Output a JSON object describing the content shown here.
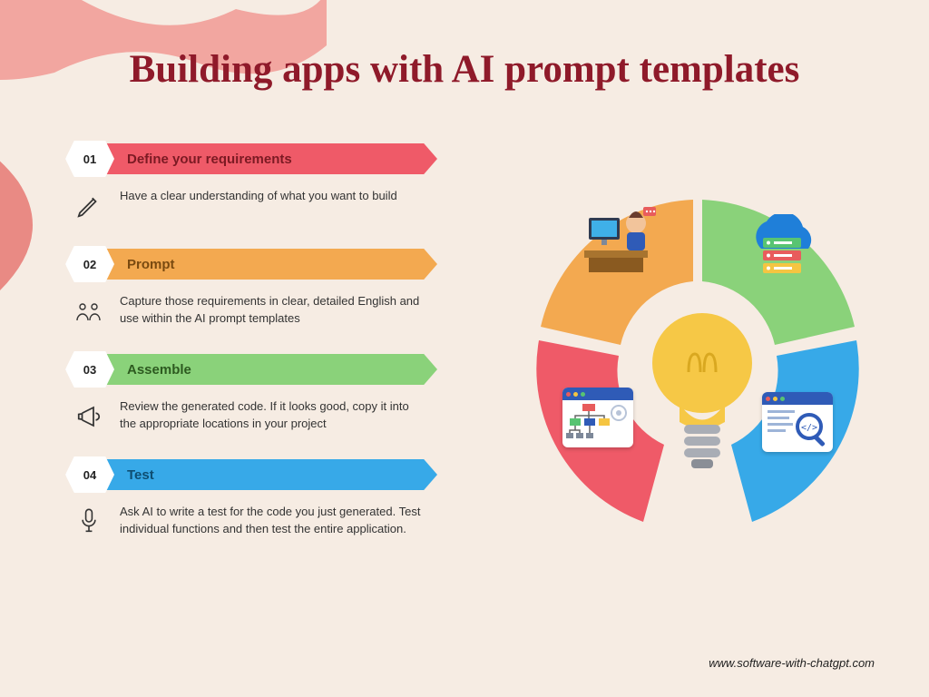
{
  "title": "Building apps with AI prompt templates",
  "footer_url": "www.software-with-chatgpt.com",
  "colors": {
    "bg": "#f6ece3",
    "title": "#8f1a2a",
    "step1": "#ef5a68",
    "step2": "#f3a950",
    "step3": "#8ad27a",
    "step4": "#37a9e8",
    "bulb": "#f6c846"
  },
  "steps": [
    {
      "num": "01",
      "title": "Define your requirements",
      "desc": "Have a clear understanding of what you want to build",
      "icon": "pencil-icon"
    },
    {
      "num": "02",
      "title": "Prompt",
      "desc": "Capture those requirements in clear, detailed English and use within the AI prompt templates",
      "icon": "people-icon"
    },
    {
      "num": "03",
      "title": "Assemble",
      "desc": "Review the generated code. If it looks good, copy it into the appropriate locations in your project",
      "icon": "megaphone-icon"
    },
    {
      "num": "04",
      "title": "Test",
      "desc": "Ask AI to write a test for the code you just generated. Test individual functions and then test the entire application.",
      "icon": "microphone-icon"
    }
  ],
  "graphic": {
    "center": "lightbulb-icon",
    "segments": [
      {
        "color": "#f3a950",
        "icon": "workstation-icon"
      },
      {
        "color": "#8ad27a",
        "icon": "cloud-server-icon"
      },
      {
        "color": "#37a9e8",
        "icon": "code-search-icon"
      },
      {
        "color": "#ef5a68",
        "icon": "flowchart-icon"
      }
    ]
  }
}
